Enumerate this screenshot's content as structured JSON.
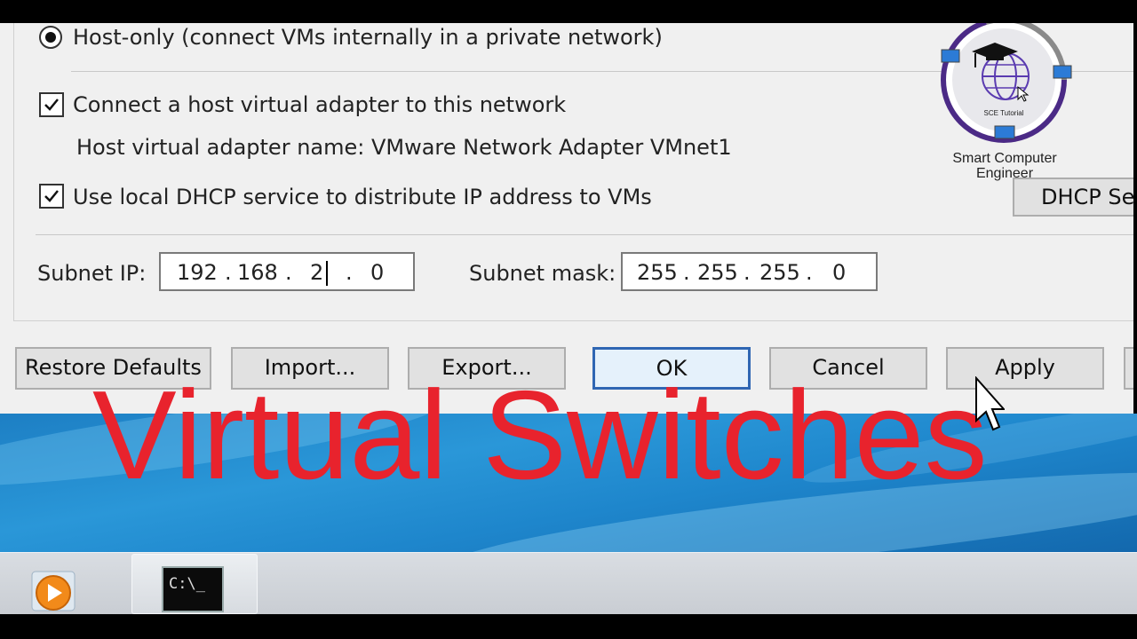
{
  "network_settings": {
    "host_only_label": "Host-only (connect VMs internally in a private network)",
    "connect_adapter_label": "Connect a host virtual adapter to this network",
    "connect_adapter_checked": true,
    "adapter_name_label": "Host virtual adapter name: VMware Network Adapter VMnet1",
    "use_dhcp_label": "Use local DHCP service to distribute IP address to VMs",
    "use_dhcp_checked": true,
    "dhcp_settings_button": "DHCP Se",
    "subnet_ip_label": "Subnet IP:",
    "subnet_ip": [
      "192",
      "168",
      "2",
      "0"
    ],
    "subnet_mask_label": "Subnet mask:",
    "subnet_mask": [
      "255",
      "255",
      "255",
      "0"
    ]
  },
  "buttons": {
    "restore_defaults": "Restore Defaults",
    "import": "Import...",
    "export": "Export...",
    "ok": "OK",
    "cancel": "Cancel",
    "apply": "Apply"
  },
  "overlay_title": "Virtual Switches",
  "watermark": {
    "badge_text": "SCE Tutorial",
    "name": "Smart Computer Engineer"
  },
  "taskbar": {
    "cmd_icon_text": "C:\\_"
  },
  "colors": {
    "overlay_red": "#e8232d",
    "dialog_bg": "#f0f0f0",
    "default_button_border": "#2f66b3",
    "desktop_blue": "#1e86cc"
  },
  "icons": [
    "media-player-icon",
    "command-prompt-icon",
    "mouse-pointer-icon",
    "checkmark-icon",
    "globe-graduation-icon"
  ]
}
